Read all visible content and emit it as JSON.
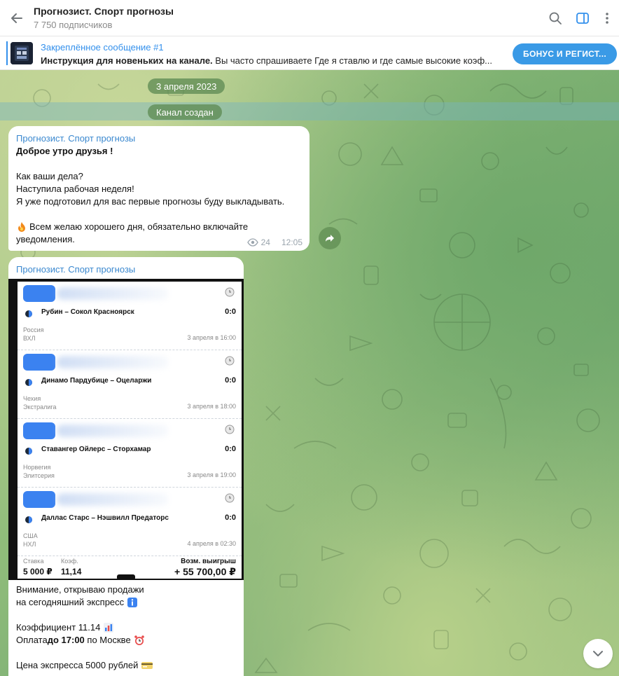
{
  "header": {
    "title": "Прогнозист. Спорт прогнозы",
    "subscribers": "7 750 подписчиков"
  },
  "pinned": {
    "title": "Закреплённое сообщение #1",
    "text_bold": "Инструкция для новеньких на канале.",
    "text_rest": " Вы часто спрашиваете  Где я ставлю и где самые высокие коэф...",
    "button": "БОНУС И РЕГИСТ..."
  },
  "chat": {
    "date_label": "3 апреля 2023",
    "service_label": "Канал создан",
    "message1": {
      "author": "Прогнозист. Спорт прогнозы",
      "greeting": "Доброе утро друзья !",
      "lines": [
        "Как ваши дела?",
        "Наступила рабочая неделя!",
        "Я уже подготовил для вас первые прогнозы буду выкладывать."
      ],
      "wish_line1": "Всем желаю хорошего дня, обязательно включайте",
      "wish_line2": "уведомления.",
      "views": "24",
      "time": "12:05"
    },
    "message2": {
      "author": "Прогнозист. Спорт прогнозы",
      "slip": {
        "matches": [
          {
            "teams": "Рубин – Сокол Красноярск",
            "score": "0:0",
            "country": "Россия",
            "league": "ВХЛ",
            "when": "3 апреля в 16:00"
          },
          {
            "teams": "Динамо Пардубице – Оцеларжи",
            "score": "0:0",
            "country": "Чехия",
            "league": "Экстралига",
            "when": "3 апреля в 18:00"
          },
          {
            "teams": "Ставангер Ойлерс – Сторхамар",
            "score": "0:0",
            "country": "Норвегия",
            "league": "Элитсерия",
            "when": "3 апреля в 19:00"
          },
          {
            "teams": "Даллас Старс – Нэшвилл Предаторс",
            "score": "0:0",
            "country": "США",
            "league": "НХЛ",
            "when": "4 апреля в 02:30"
          }
        ],
        "stake_label": "Ставка",
        "stake_value": "5 000 ₽",
        "coef_label": "Коэф.",
        "coef_value": "11,14",
        "win_label": "Возм. выигрыш",
        "win_value": "+ 55 700,00 ₽"
      },
      "text": {
        "l1": "Внимание, открываю продажи",
        "l2": "на сегодняшний экспресс",
        "l3": "Коэффициент 11.14",
        "l4_pre": "Оплата ",
        "l4_bold": "до 17:00",
        "l4_post": " по Москве",
        "l5": "Цена экспресса 5000 рублей"
      }
    }
  },
  "icons": [
    "back-arrow-icon",
    "search-icon",
    "sidebar-toggle-icon",
    "more-vertical-icon",
    "eye-icon",
    "forward-icon",
    "chevron-down-icon",
    "clock-icon",
    "fire-emoji-icon"
  ],
  "colors": {
    "accent": "#3390ec",
    "button": "#3a9ae6",
    "author": "#3a88cf"
  }
}
